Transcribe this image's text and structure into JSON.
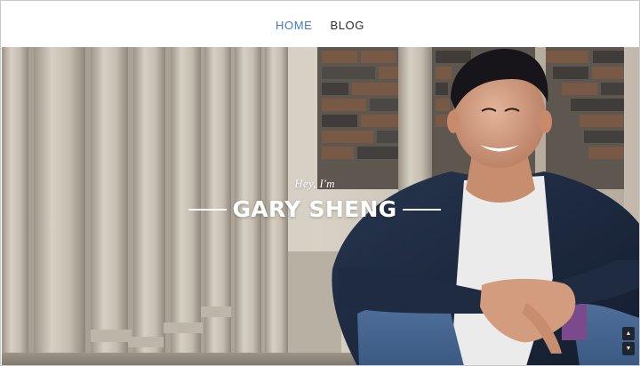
{
  "nav": {
    "items": [
      {
        "label": "HOME",
        "active": true
      },
      {
        "label": "BLOG",
        "active": false
      }
    ]
  },
  "hero": {
    "greeting": "Hey, I'm",
    "name": "GARY SHENG"
  },
  "scroll": {
    "up_icon": "triangle-up",
    "down_icon": "triangle-down"
  },
  "colors": {
    "nav_active": "#3d7ac7",
    "nav_text": "#2b2b2b",
    "hero_text": "#ffffff"
  }
}
